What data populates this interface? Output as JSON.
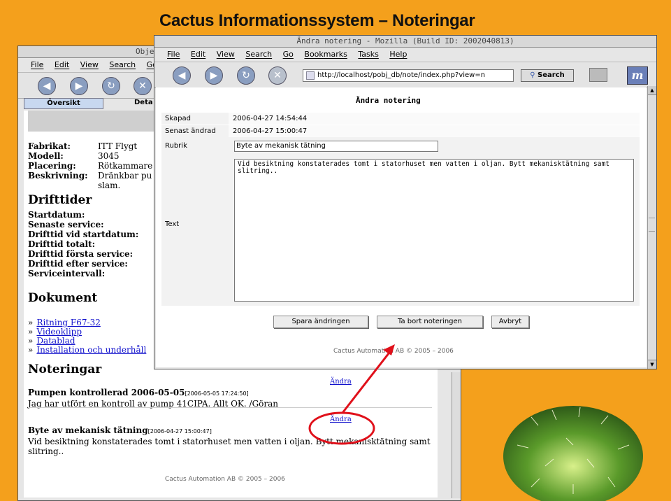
{
  "slide": {
    "title": "Cactus Informationssystem – Noteringar"
  },
  "back_window": {
    "title": "Obje",
    "menu": [
      "File",
      "Edit",
      "View",
      "Search",
      "Go"
    ],
    "tabs": [
      "Översikt",
      "Deta"
    ],
    "info": [
      {
        "label": "Fabrikat:",
        "value": "ITT Flygt"
      },
      {
        "label": "Modell:",
        "value": "3045"
      },
      {
        "label": "Placering:",
        "value": "Rötkammare"
      },
      {
        "label": "Beskrivning:",
        "value": "Dränkbar pu"
      }
    ],
    "info_cont": "slam.",
    "drifttider": {
      "heading": "Drifttider",
      "fields": [
        "Startdatum:",
        "Senaste service:",
        "Drifttid vid startdatum:",
        "Drifttid totalt:",
        "Drifttid första service:",
        "Drifttid efter service:",
        "Serviceintervall:"
      ]
    },
    "dokument": {
      "heading": "Dokument",
      "bullet": "»",
      "links": [
        "Ritning F67-32",
        "Videoklipp",
        "Datablad",
        "Installation och underhåll"
      ]
    },
    "noteringar": {
      "heading": "Noteringar",
      "notes": [
        {
          "title": "Pumpen kontrollerad 2006-05-05",
          "ts": "[2006-05-05 17:24:50]",
          "body": "Jag har utfört en kontroll av pump 41CIPA. Allt OK. /Göran",
          "edit": "Ändra"
        },
        {
          "title": "Byte av mekanisk tätning",
          "ts": "[2006-04-27 15:00:47]",
          "body": "Vid besiktning konstaterades tomt i statorhuset men vatten i oljan. Bytt mekanisktätning samt slitring..",
          "edit": "Ändra"
        }
      ]
    },
    "footer": "Cactus Automation AB © 2005 – 2006"
  },
  "front_window": {
    "title": "Ändra notering - Mozilla (Build ID: 2002040813)",
    "menu": [
      "File",
      "Edit",
      "View",
      "Search",
      "Go",
      "Bookmarks",
      "Tasks",
      "Help"
    ],
    "url": "http://localhost/pobj_db/note/index.php?view=n",
    "search_label": "Search",
    "heading": "Ändra notering",
    "rows": [
      {
        "label": "Skapad",
        "value": "2006-04-27 14:54:44"
      },
      {
        "label": "Senast ändrad",
        "value": "2006-04-27 15:00:47"
      }
    ],
    "rubrik_label": "Rubrik",
    "rubrik_value": "Byte av mekanisk tätning",
    "text_label": "Text",
    "text_value": "Vid besiktning konstaterades tomt i statorhuset men vatten i oljan. Bytt mekanisktätning samt slitring..",
    "buttons": {
      "save": "Spara ändringen",
      "delete": "Ta bort noteringen",
      "cancel": "Avbryt"
    },
    "footer": "Cactus Automation AB © 2005 – 2006"
  },
  "colors": {
    "background": "#f4a01c",
    "annotation": "#e0101a",
    "link": "#1010cc"
  }
}
